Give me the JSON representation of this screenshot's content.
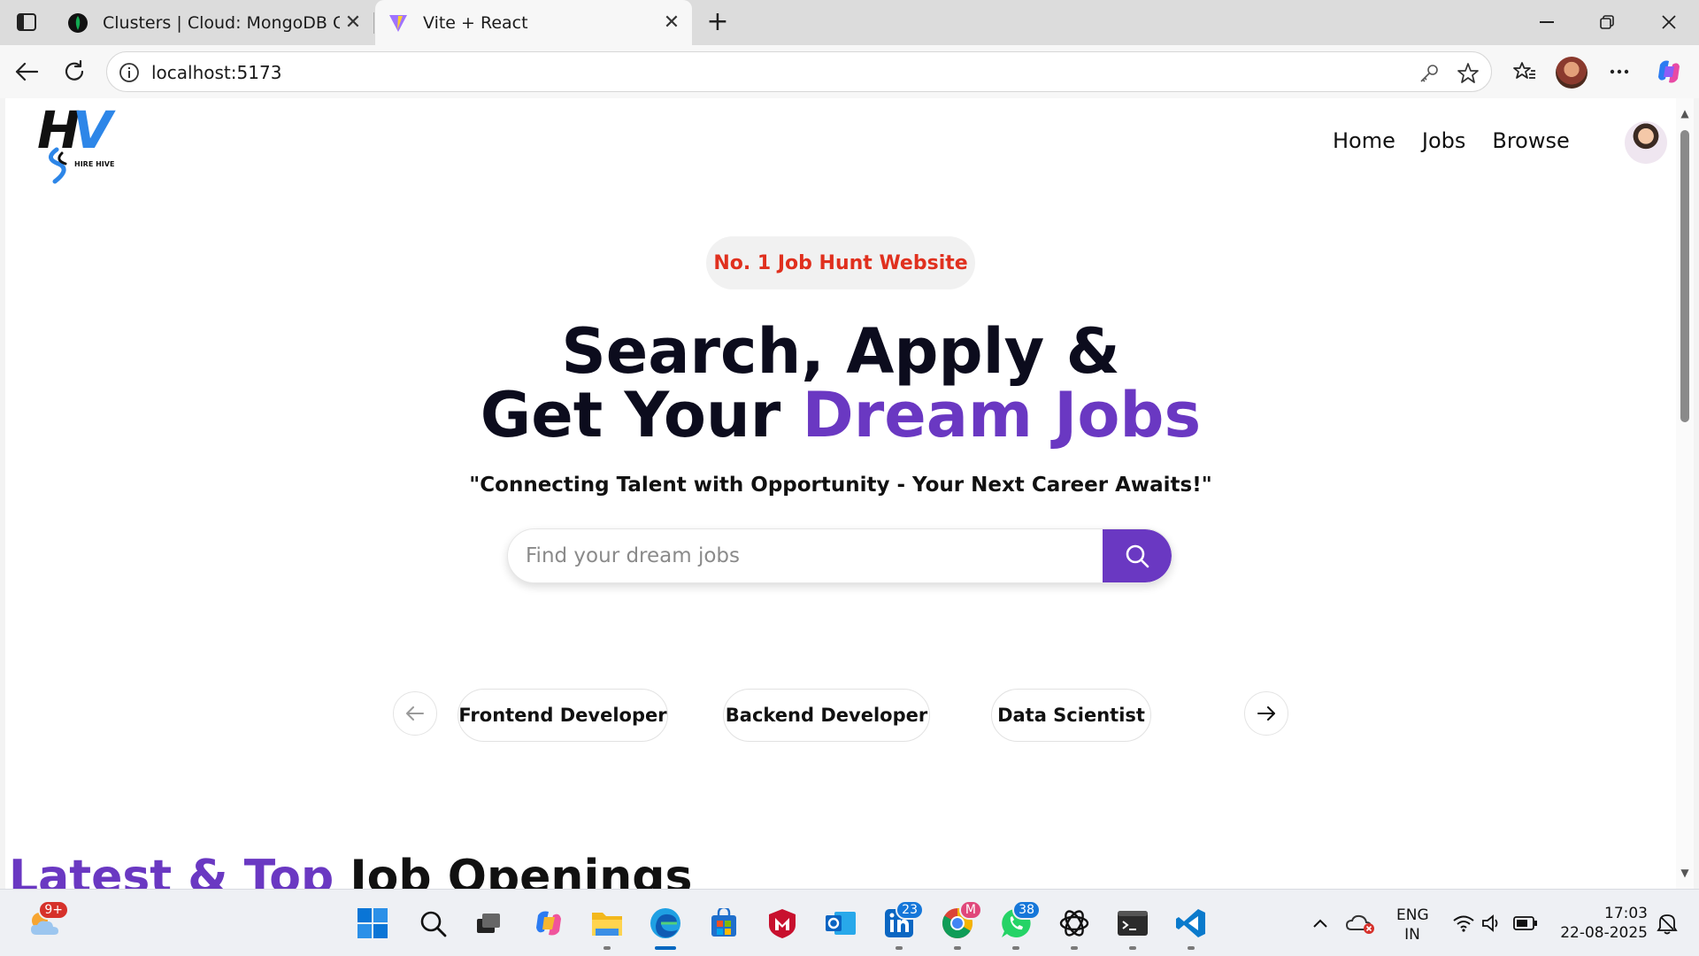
{
  "browser": {
    "tabs": [
      {
        "title": "Clusters | Cloud: MongoDB Cloud",
        "active": false
      },
      {
        "title": "Vite + React",
        "active": true
      }
    ],
    "url": "localhost:5173"
  },
  "site": {
    "logo_text": "HV",
    "logo_subtext": "HIRE HIVE",
    "nav": [
      "Home",
      "Jobs",
      "Browse"
    ]
  },
  "hero": {
    "badge": "No. 1 Job Hunt Website",
    "headline_line1": "Search, Apply &",
    "headline_line2_plain": "Get Your ",
    "headline_line2_accent": "Dream Jobs",
    "subline": "\"Connecting Talent with Opportunity - Your Next Career Awaits!\"",
    "search_placeholder": "Find your dream jobs"
  },
  "categories": [
    "Frontend Developer",
    "Backend Developer",
    "Data Scientist"
  ],
  "section": {
    "title_accent": "Latest & Top",
    "title_plain": " Job Openings"
  },
  "taskbar": {
    "weather_badge": "9+",
    "linkedin_badge": "23",
    "chrome_badge": "M",
    "whatsapp_badge": "38",
    "lang_top": "ENG",
    "lang_bottom": "IN",
    "time": "17:03",
    "date": "22-08-2025"
  },
  "colors": {
    "accent": "#6a38c2",
    "badge_text": "#e0301e"
  }
}
